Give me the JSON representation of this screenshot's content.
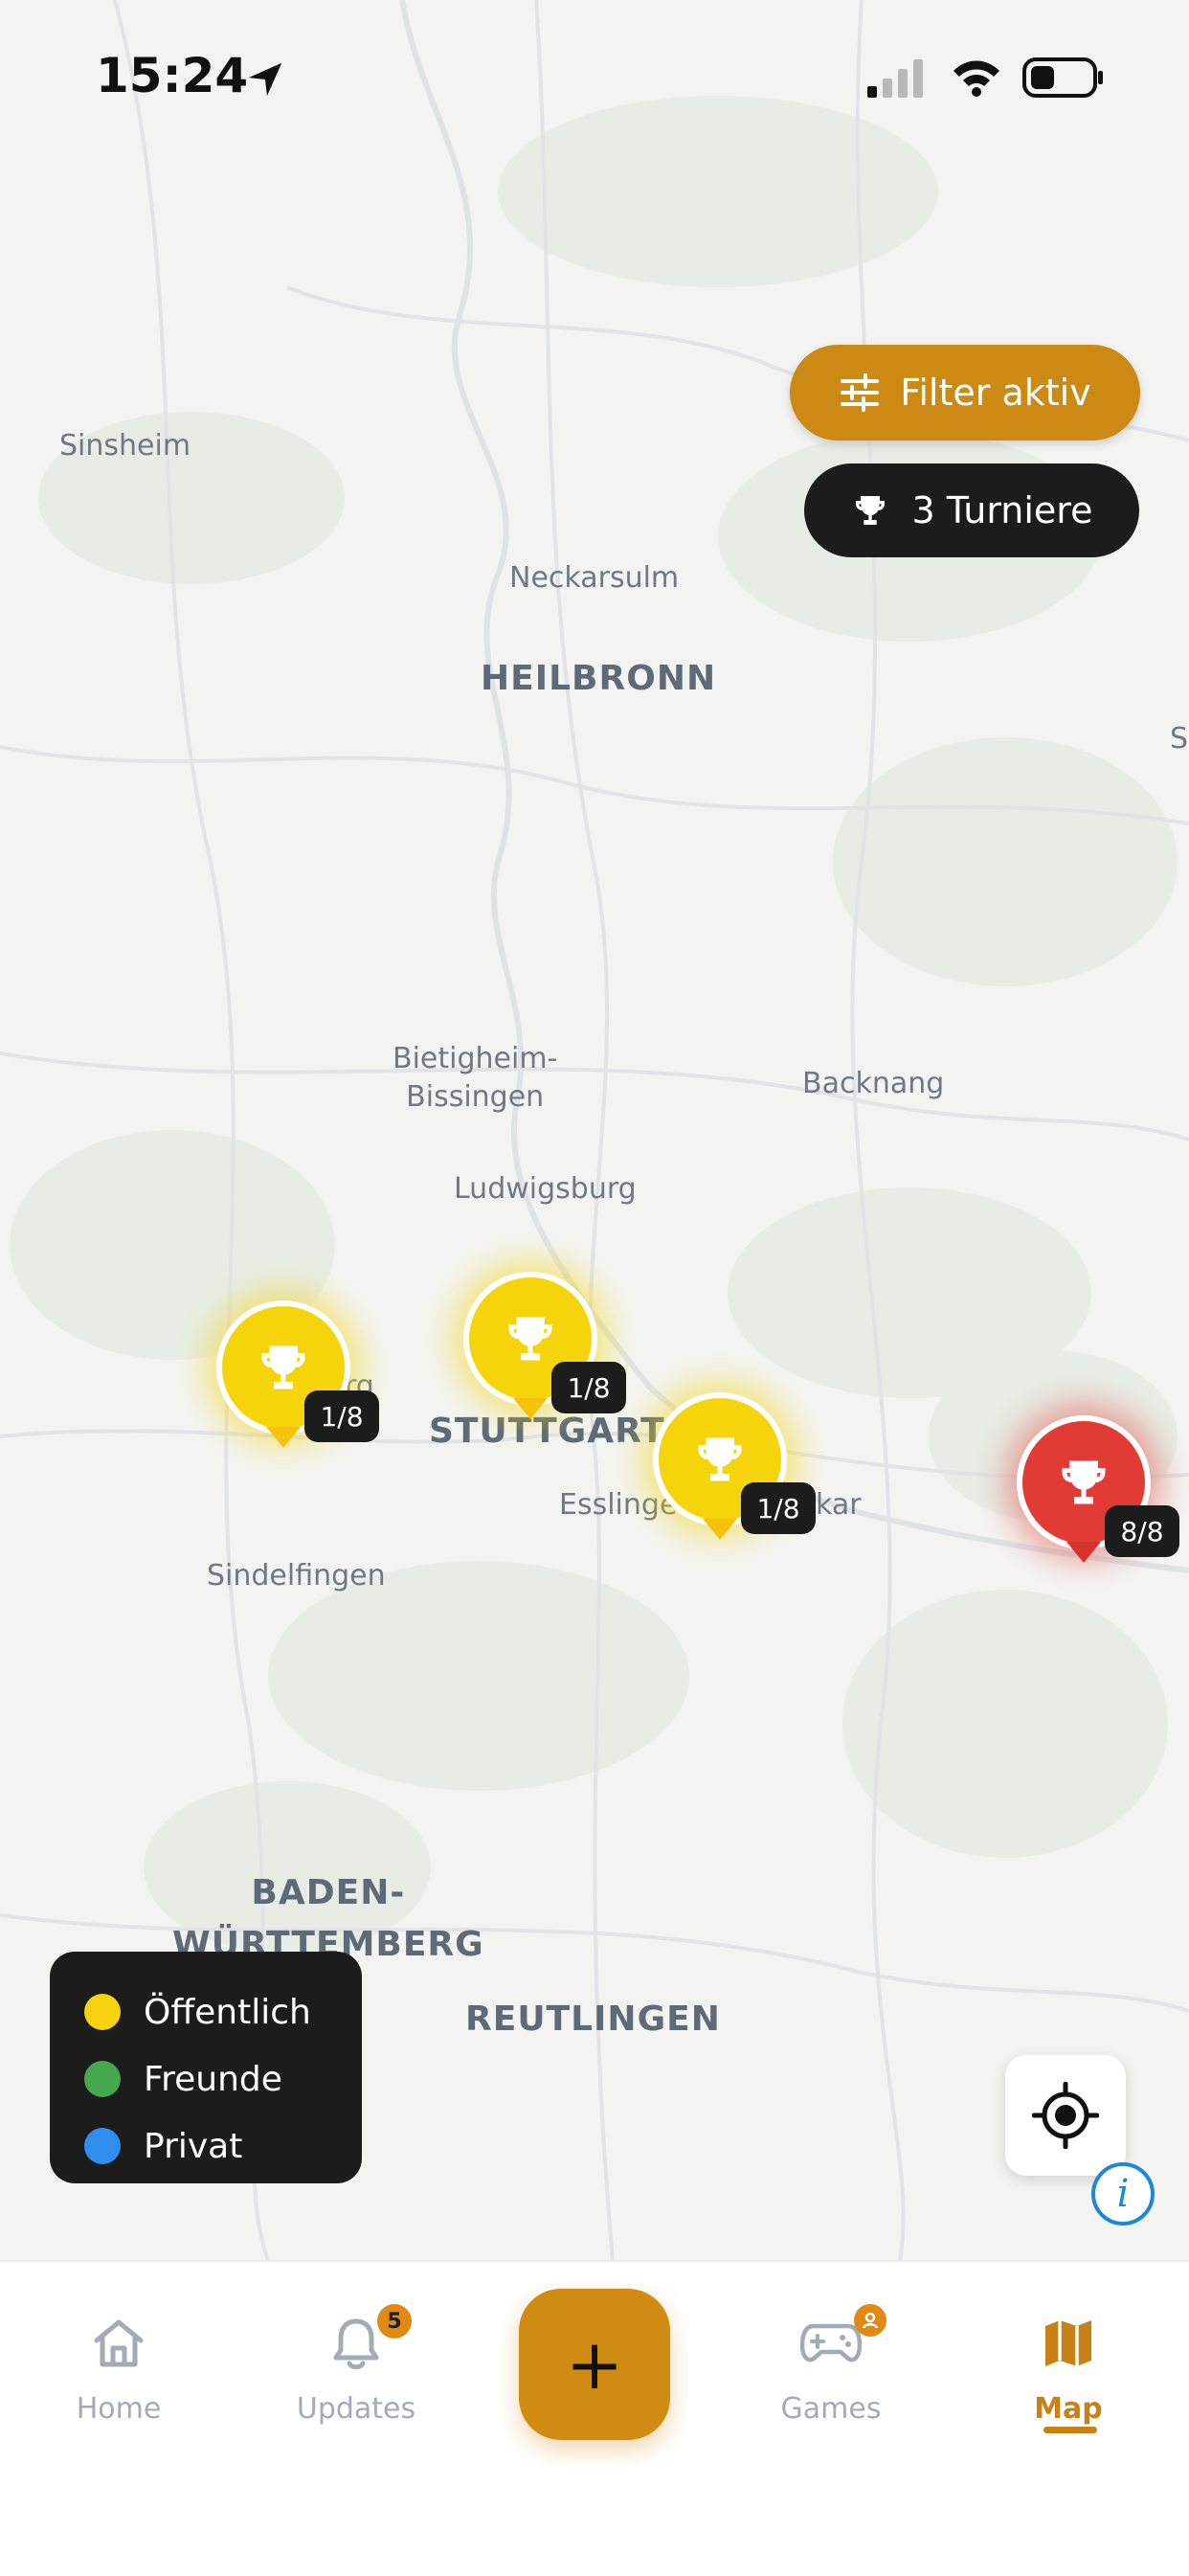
{
  "status_bar": {
    "time": "15:24"
  },
  "map": {
    "cities": {
      "sinsheim": "Sinsheim",
      "neckarsulm": "Neckarsulm",
      "heilbronn": "HEILBRONN",
      "bietigheim": "Bietigheim-\nBissingen",
      "backnang": "Backnang",
      "ludwigsburg": "Ludwigsburg",
      "stuttgart": "STUTTGART",
      "esslingen": "Esslinge",
      "neckar_frag": "kar",
      "leonberg_frag": "rg",
      "sindelfingen": "Sindelfingen",
      "bw": "BADEN-\nWÜRTTEMBERG",
      "reutlingen": "REUTLINGEN",
      "edge_s": "S"
    },
    "markers": [
      {
        "name": "tournament-marker-1",
        "count": "1/8",
        "type": "Öffentlich",
        "color": "#f5d40c"
      },
      {
        "name": "tournament-marker-2",
        "count": "1/8",
        "type": "Öffentlich",
        "color": "#f5d40c"
      },
      {
        "name": "tournament-marker-3",
        "count": "1/8",
        "type": "Öffentlich",
        "color": "#f5d40c"
      },
      {
        "name": "tournament-marker-4",
        "count": "8/8",
        "color": "#e23b35"
      }
    ]
  },
  "filter": {
    "label": "Filter aktiv",
    "icon": "sliders-icon",
    "color": "#cc8a15"
  },
  "tournaments": {
    "label": "3 Turniere",
    "icon": "trophy-icon"
  },
  "legend": [
    {
      "label": "Öffentlich",
      "color": "#f7d20f"
    },
    {
      "label": "Freunde",
      "color": "#45a84d"
    },
    {
      "label": "Privat",
      "color": "#2f8ff0"
    }
  ],
  "nav": {
    "home": "Home",
    "updates": "Updates",
    "updates_badge": "5",
    "games": "Games",
    "map": "Map",
    "fab": "+"
  }
}
